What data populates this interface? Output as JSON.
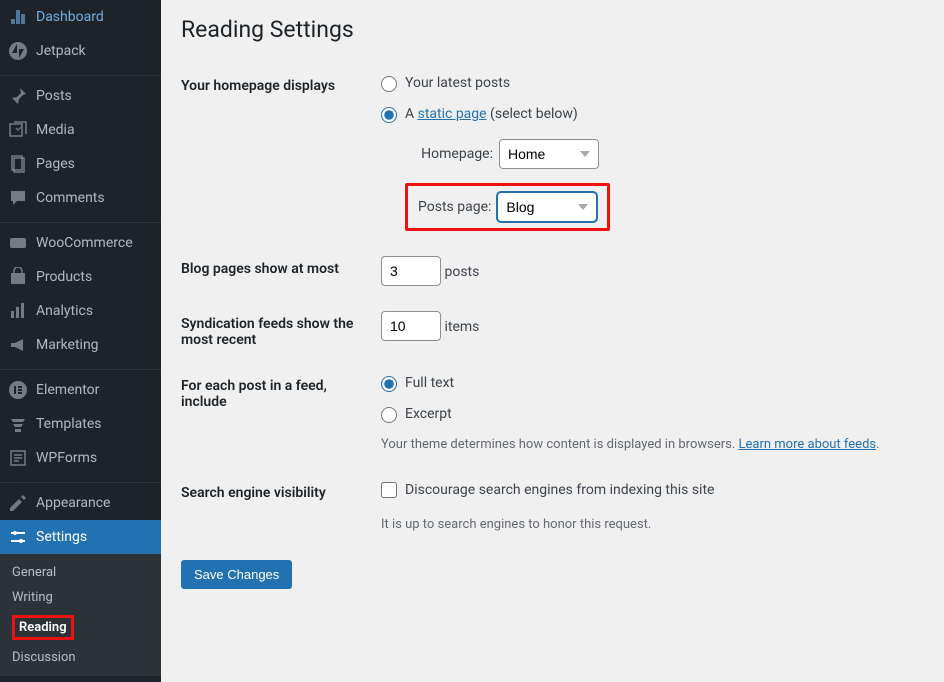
{
  "sidebar": {
    "items": [
      {
        "label": "Dashboard",
        "icon": "dashboard"
      },
      {
        "label": "Jetpack",
        "icon": "jetpack"
      },
      {
        "label": "Posts",
        "icon": "pin"
      },
      {
        "label": "Media",
        "icon": "media"
      },
      {
        "label": "Pages",
        "icon": "pages"
      },
      {
        "label": "Comments",
        "icon": "comments"
      },
      {
        "label": "WooCommerce",
        "icon": "woo"
      },
      {
        "label": "Products",
        "icon": "products"
      },
      {
        "label": "Analytics",
        "icon": "analytics"
      },
      {
        "label": "Marketing",
        "icon": "marketing"
      },
      {
        "label": "Elementor",
        "icon": "elementor"
      },
      {
        "label": "Templates",
        "icon": "templates"
      },
      {
        "label": "WPForms",
        "icon": "wpforms"
      },
      {
        "label": "Appearance",
        "icon": "appearance"
      },
      {
        "label": "Settings",
        "icon": "settings"
      }
    ],
    "submenu": [
      "General",
      "Writing",
      "Reading",
      "Discussion"
    ]
  },
  "page": {
    "title": "Reading Settings",
    "homepage_displays_label": "Your homepage displays",
    "radio_latest": "Your latest posts",
    "radio_static_pre": "A ",
    "static_page_link": "static page",
    "radio_static_post": " (select below)",
    "homepage_label": "Homepage:",
    "homepage_value": "Home",
    "posts_page_label": "Posts page:",
    "posts_page_value": "Blog",
    "blog_pages_label": "Blog pages show at most",
    "blog_pages_value": "3",
    "blog_pages_unit": "posts",
    "syndication_label": "Syndication feeds show the most recent",
    "syndication_value": "10",
    "syndication_unit": "items",
    "feed_include_label": "For each post in a feed, include",
    "feed_full": "Full text",
    "feed_excerpt": "Excerpt",
    "feed_description_pre": "Your theme determines how content is displayed in browsers. ",
    "feed_description_link": "Learn more about feeds",
    "feed_description_post": ".",
    "visibility_label": "Search engine visibility",
    "visibility_checkbox": "Discourage search engines from indexing this site",
    "visibility_description": "It is up to search engines to honor this request.",
    "save_button": "Save Changes"
  }
}
